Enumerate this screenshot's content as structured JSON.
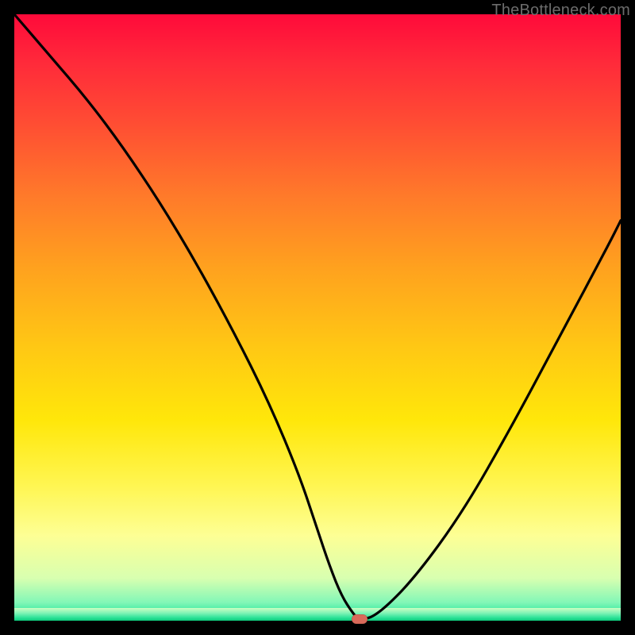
{
  "watermark": "TheBottleneck.com",
  "colors": {
    "curve": "#000000",
    "marker": "#d96a5a"
  },
  "chart_data": {
    "type": "line",
    "title": "",
    "xlabel": "",
    "ylabel": "",
    "xlim": [
      0,
      100
    ],
    "ylim": [
      0,
      100
    ],
    "grid": false,
    "legend": false,
    "annotations": [
      {
        "kind": "min-marker",
        "x": 57,
        "y": 0
      }
    ],
    "series": [
      {
        "name": "bottleneck-curve",
        "x": [
          0,
          6,
          12,
          18,
          24,
          30,
          36,
          42,
          47,
          50,
          52,
          54,
          56,
          57,
          60,
          66,
          74,
          82,
          90,
          98,
          100
        ],
        "y": [
          100,
          93,
          86,
          78,
          69,
          59,
          48,
          36,
          24,
          15,
          9,
          4,
          1,
          0,
          1,
          7,
          18,
          32,
          47,
          62,
          66
        ]
      }
    ],
    "comment": "Values estimated from pixel positions relative to the 764x764 plot area; y=0 is bottom edge, y=100 is top edge."
  }
}
